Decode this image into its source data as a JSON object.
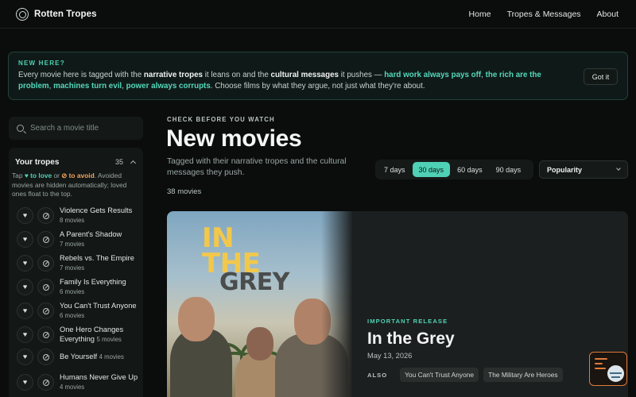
{
  "header": {
    "brand": "Rotten Tropes",
    "nav": [
      "Home",
      "Tropes & Messages",
      "About"
    ]
  },
  "banner": {
    "title": "NEW HERE?",
    "t1": "Every movie here is tagged with the ",
    "b1": "narrative tropes",
    "t2": " it leans on and the ",
    "b2": "cultural messages",
    "t3": " it pushes — ",
    "h1": "hard work always pays off",
    "t4": ", ",
    "h2": "the rich are the problem",
    "t5": ", ",
    "h3": "machines turn evil",
    "t6": ", ",
    "h4": "power always corrupts",
    "t7": ". Choose films by what they argue, not just what they're about.",
    "button": "Got it"
  },
  "sidebar": {
    "search_placeholder": "Search a movie title",
    "tropes_title": "Your tropes",
    "tropes_count": "35",
    "help": {
      "a": "Tap ",
      "love": "♥ to love",
      "b": " or ",
      "avoid": "⊘ to avoid",
      "c": ". Avoided movies are hidden automatically; loved ones float to the top."
    },
    "tropes": [
      {
        "name": "Violence Gets Results",
        "count": "8 movies"
      },
      {
        "name": "A Parent's Shadow",
        "count": "7 movies"
      },
      {
        "name": "Rebels vs. The Empire",
        "count": "7 movies"
      },
      {
        "name": "Family Is Everything",
        "count": "6 movies"
      },
      {
        "name": "You Can't Trust Anyone",
        "count": "6 movies"
      },
      {
        "name": "One Hero Changes Everything",
        "count": "5 movies"
      },
      {
        "name": "Be Yourself",
        "count": "4 movies"
      },
      {
        "name": "Humans Never Give Up",
        "count": "4 movies"
      }
    ]
  },
  "main": {
    "eyebrow": "CHECK BEFORE YOU WATCH",
    "title": "New movies",
    "subtitle": "Tagged with their narrative tropes and the cultural messages they push.",
    "count": "38 movies",
    "ranges": [
      "7 days",
      "30 days",
      "60 days",
      "90 days"
    ],
    "active_range": "30 days",
    "sort": "Popularity"
  },
  "feature": {
    "poster_line1": "IN",
    "poster_line2": "THE",
    "poster_line3": "GREY",
    "tag": "IMPORTANT RELEASE",
    "title": "In the Grey",
    "date": "May 13, 2026",
    "also_label": "ALSO",
    "chips": [
      "You Can't Trust Anyone",
      "The Military Are Heroes"
    ]
  },
  "colors": {
    "accent": "#4fd1b5",
    "avoid": "#f0a35b",
    "background": "#0b0d0d"
  }
}
